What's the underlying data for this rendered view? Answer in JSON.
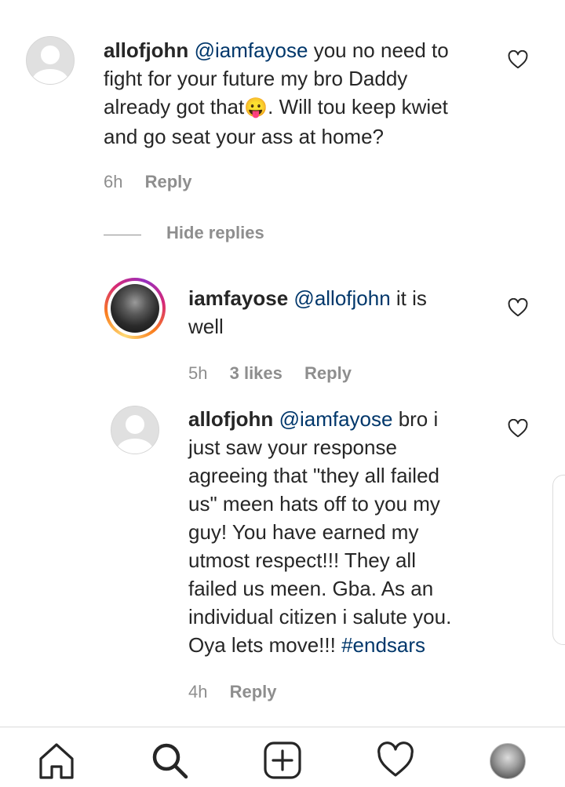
{
  "comments": [
    {
      "username": "allofjohn",
      "mention": "@iamfayose",
      "body_line1_rest": " you no need to",
      "body_line2": "fight for your future my bro Daddy",
      "body_line3_pre": "already got that",
      "emoji": "😛",
      "body_line3_post": ". Will tou keep kwiet",
      "body_line4": "and go seat your ass at home?",
      "time": "6h",
      "reply_label": "Reply"
    },
    {
      "username": "iamfayose",
      "mention": "@allofjohn",
      "body_line1_rest": " it is",
      "body_line2": "well",
      "time": "5h",
      "likes": "3 likes",
      "reply_label": "Reply"
    },
    {
      "username": "allofjohn",
      "mention": "@iamfayose",
      "body_line1_rest": " bro i",
      "lines": [
        "just saw your response",
        "agreeing that \"they all failed",
        "us\" meen hats off to you my",
        "guy! You have earned my",
        "utmost respect!!! They all",
        "failed us meen. Gba. As an",
        "individual citizen i salute you."
      ],
      "last_line_pre": "Oya lets move!!! ",
      "hashtag": "#endsars",
      "time": "4h",
      "reply_label": "Reply"
    }
  ],
  "hide_replies_label": "Hide replies",
  "icons": {
    "like": "heart-outline-icon",
    "home": "home-icon",
    "search": "search-icon",
    "new_post": "plus-square-icon",
    "activity": "heart-icon",
    "profile": "profile-avatar"
  }
}
